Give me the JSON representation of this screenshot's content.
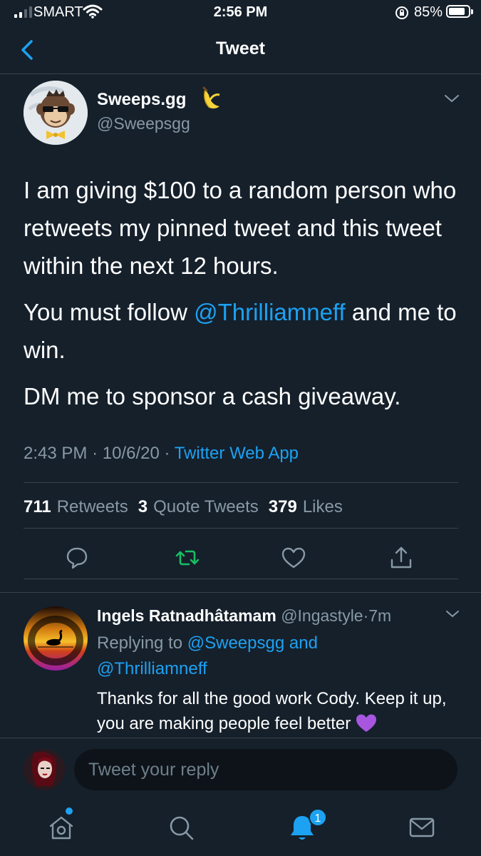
{
  "status_bar": {
    "carrier": "SMART",
    "time": "2:56 PM",
    "battery_percent": "85%",
    "battery_level": 0.85
  },
  "header": {
    "title": "Tweet"
  },
  "tweet": {
    "author_name": "Sweeps.gg",
    "author_emoji": "banana-icon",
    "author_handle": "@Sweepsgg",
    "paragraph1": "I am giving $100 to a random person who retweets my pinned tweet and this tweet within the next 12 hours.",
    "paragraph2_before": "You must follow ",
    "paragraph2_mention": "@Thrilliamneff",
    "paragraph2_after": " and me to win.",
    "paragraph3": "DM me to sponsor a cash giveaway.",
    "time": "2:43 PM",
    "date": "10/6/20",
    "meta_sep": "·",
    "source": "Twitter Web App",
    "retweets_count": "711",
    "retweets_label": "Retweets",
    "quotes_count": "3",
    "quotes_label": "Quote Tweets",
    "likes_count": "379",
    "likes_label": "Likes"
  },
  "reply": {
    "name": "Ingels Ratnadhâtamam",
    "handle": "@Ingastyle",
    "dot": "·",
    "time": "7m",
    "replying_prefix": "Replying to ",
    "replying_to1": "@Sweepsgg",
    "replying_and": " and",
    "replying_to2": "@Thrilliamneff",
    "text": "Thanks for all the good work Cody. Keep it up, you are making people feel better "
  },
  "composer": {
    "placeholder": "Tweet your reply"
  },
  "tab_bar": {
    "notifications_badge": "1"
  },
  "colors": {
    "background": "#15202b",
    "accent": "#1da1f2",
    "retweet_green": "#17bf63",
    "muted": "#8899a6"
  }
}
